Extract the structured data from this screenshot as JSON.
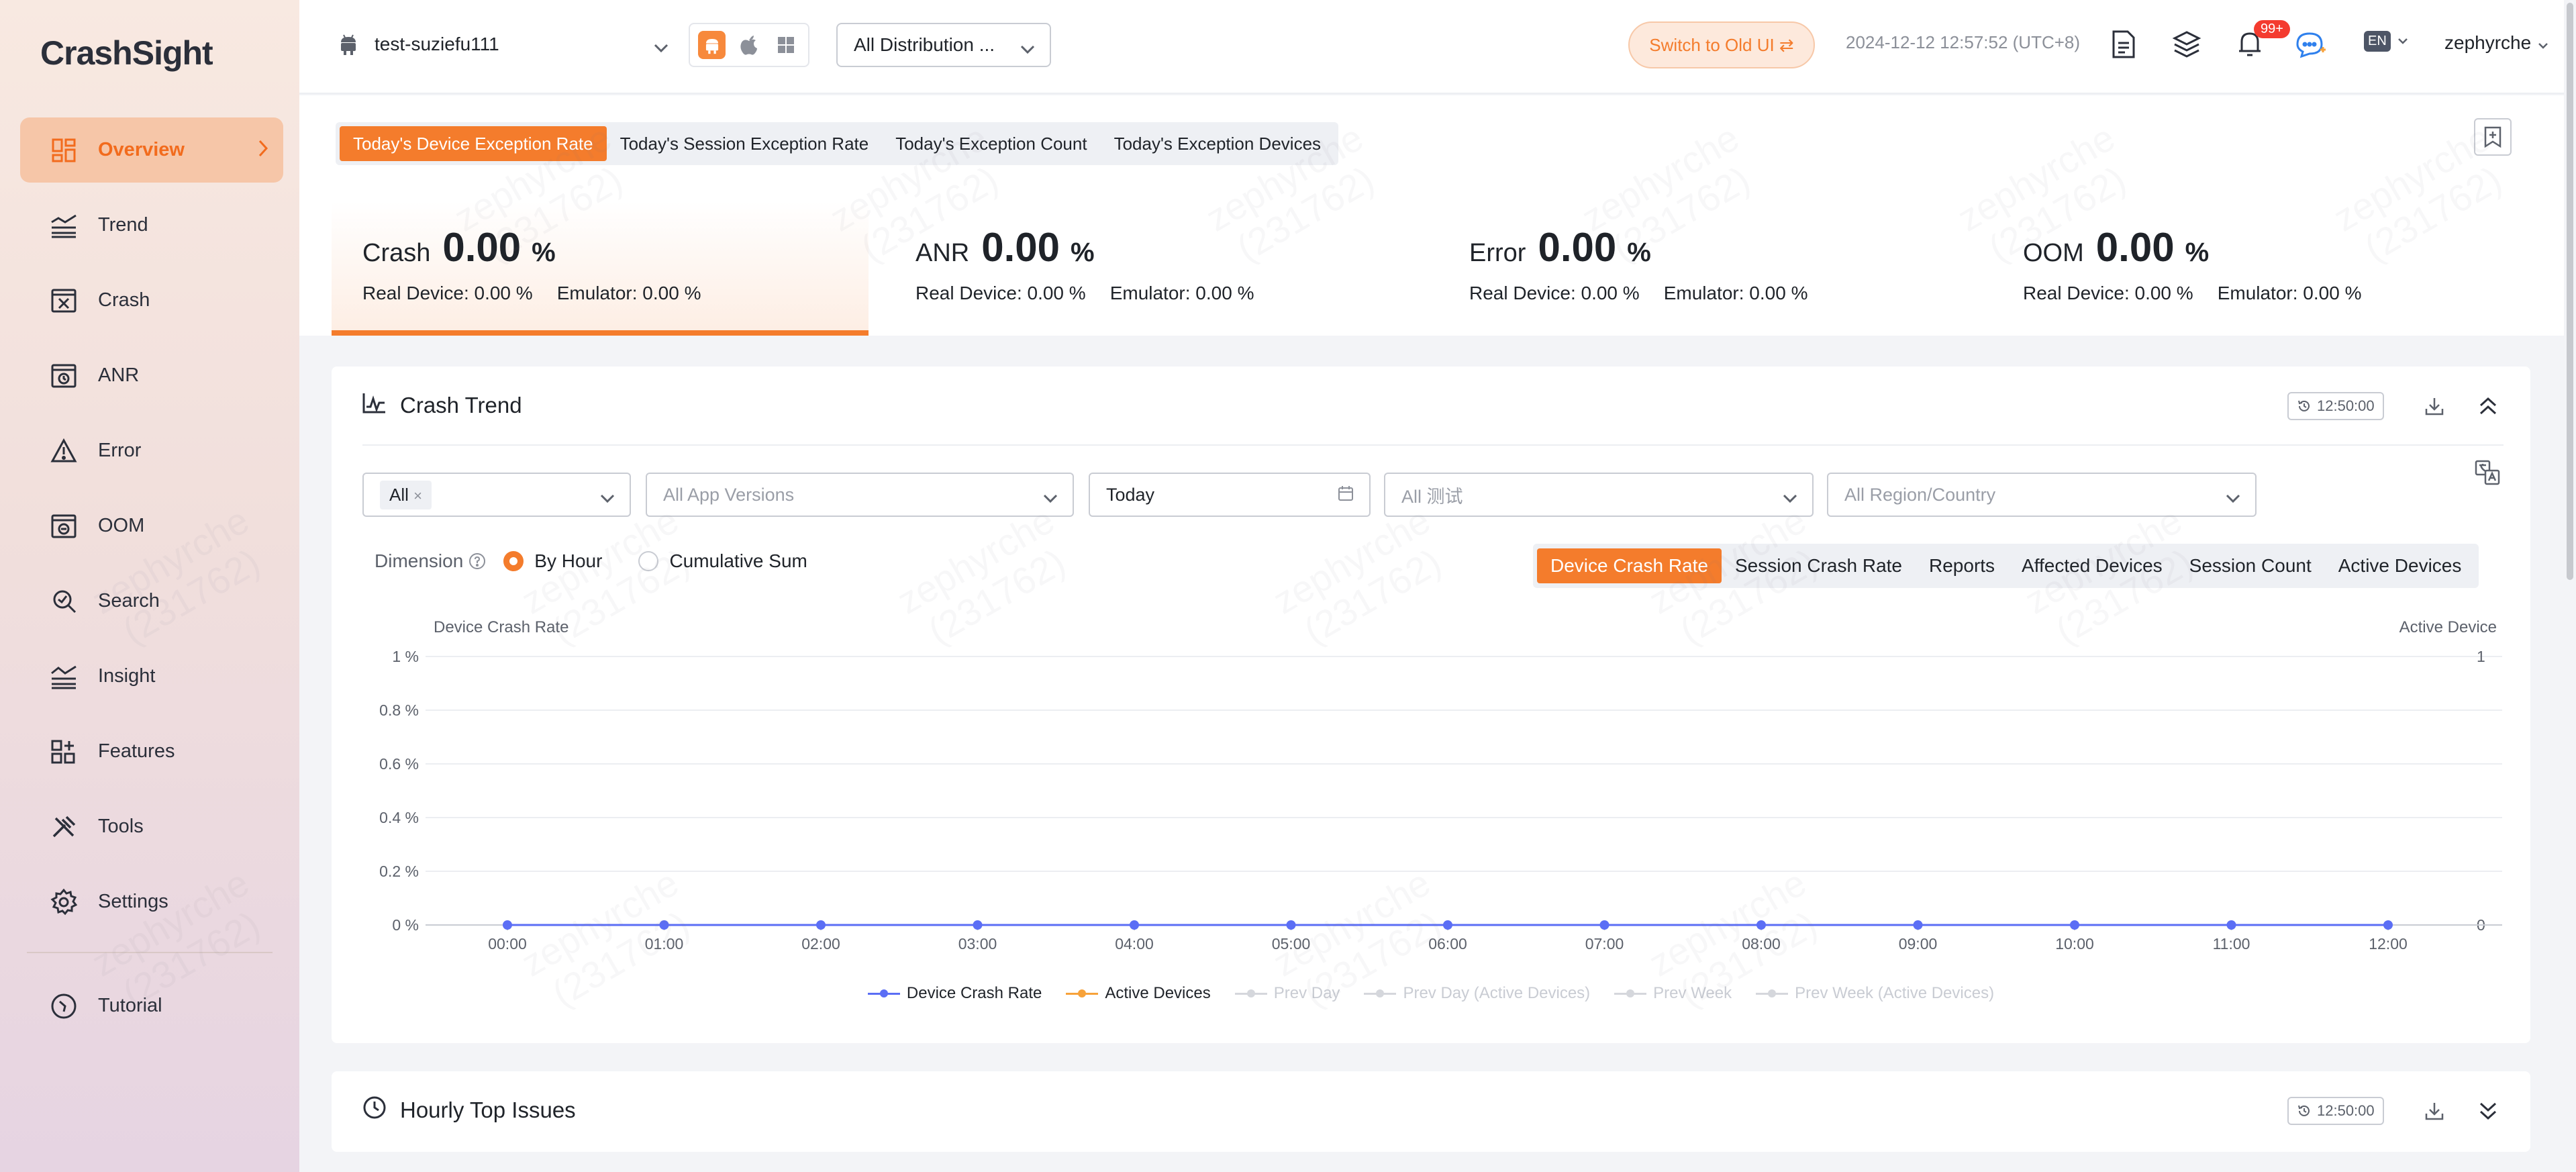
{
  "app": {
    "logo": "CrashSight"
  },
  "sidebar": {
    "items": [
      {
        "label": "Overview",
        "icon": "grid-icon"
      },
      {
        "label": "Trend",
        "icon": "trend-icon"
      },
      {
        "label": "Crash",
        "icon": "crash-icon"
      },
      {
        "label": "ANR",
        "icon": "anr-icon"
      },
      {
        "label": "Error",
        "icon": "warning-icon"
      },
      {
        "label": "OOM",
        "icon": "oom-icon"
      },
      {
        "label": "Search",
        "icon": "search-icon"
      },
      {
        "label": "Insight",
        "icon": "insight-icon"
      },
      {
        "label": "Features",
        "icon": "features-icon"
      },
      {
        "label": "Tools",
        "icon": "tools-icon"
      },
      {
        "label": "Settings",
        "icon": "gear-icon"
      }
    ],
    "tutorial": "Tutorial"
  },
  "header": {
    "app_name": "test-suziefu111",
    "distribution": "All Distribution ...",
    "switch_label": "Switch to Old UI ⇄",
    "datetime": "2024-12-12 12:57:52 (UTC+8)",
    "notif_badge": "99+",
    "lang": "EN",
    "user": "zephyrche"
  },
  "kpi_tabs": [
    "Today's Device Exception Rate",
    "Today's Session Exception Rate",
    "Today's Exception Count",
    "Today's Exception Devices"
  ],
  "kpis": [
    {
      "name": "Crash",
      "value": "0.00",
      "unit": "%",
      "real": "Real Device: 0.00 %",
      "emu": "Emulator: 0.00 %"
    },
    {
      "name": "ANR",
      "value": "0.00",
      "unit": "%",
      "real": "Real Device: 0.00 %",
      "emu": "Emulator: 0.00 %"
    },
    {
      "name": "Error",
      "value": "0.00",
      "unit": "%",
      "real": "Real Device: 0.00 %",
      "emu": "Emulator: 0.00 %"
    },
    {
      "name": "OOM",
      "value": "0.00",
      "unit": "%",
      "real": "Real Device: 0.00 %",
      "emu": "Emulator: 0.00 %"
    }
  ],
  "crash_trend": {
    "title": "Crash Trend",
    "time": "12:50:00",
    "filters": {
      "tag": "All",
      "versions": "All App Versions",
      "date": "Today",
      "test": "All 测试",
      "region": "All Region/Country"
    },
    "dimension_label": "Dimension",
    "radio_by_hour": "By Hour",
    "radio_cumulative": "Cumulative Sum",
    "metric_tabs": [
      "Device Crash Rate",
      "Session Crash Rate",
      "Reports",
      "Affected Devices",
      "Session Count",
      "Active Devices"
    ]
  },
  "chart_data": {
    "type": "line",
    "ylabel": "Device Crash Rate",
    "y2label": "Active Device",
    "x": [
      "00:00",
      "01:00",
      "02:00",
      "03:00",
      "04:00",
      "05:00",
      "06:00",
      "07:00",
      "08:00",
      "09:00",
      "10:00",
      "11:00",
      "12:00"
    ],
    "y_ticks": [
      "1 %",
      "0.8 %",
      "0.6 %",
      "0.4 %",
      "0.2 %",
      "0 %"
    ],
    "y2_ticks": [
      "1",
      "0"
    ],
    "ylim": [
      0,
      1
    ],
    "y2lim": [
      0,
      1
    ],
    "series": [
      {
        "name": "Device Crash Rate",
        "color": "#5b6ef5",
        "values": [
          0,
          0,
          0,
          0,
          0,
          0,
          0,
          0,
          0,
          0,
          0,
          0,
          0
        ]
      },
      {
        "name": "Active Devices",
        "color": "#f7a23a",
        "values": [
          0,
          0,
          0,
          0,
          0,
          0,
          0,
          0,
          0,
          0,
          0,
          0,
          0
        ]
      }
    ],
    "legend": [
      {
        "name": "Device Crash Rate",
        "color": "#5b6ef5",
        "active": true
      },
      {
        "name": "Active Devices",
        "color": "#f7a23a",
        "active": true
      },
      {
        "name": "Prev Day",
        "color": "#d5d7dc",
        "active": false
      },
      {
        "name": "Prev Day (Active Devices)",
        "color": "#d5d7dc",
        "active": false
      },
      {
        "name": "Prev Week",
        "color": "#d5d7dc",
        "active": false
      },
      {
        "name": "Prev Week (Active Devices)",
        "color": "#d5d7dc",
        "active": false
      }
    ],
    "grid": true
  },
  "hourly": {
    "title": "Hourly Top Issues",
    "time": "12:50:00"
  },
  "watermark": "zephyrche\n(231762)"
}
